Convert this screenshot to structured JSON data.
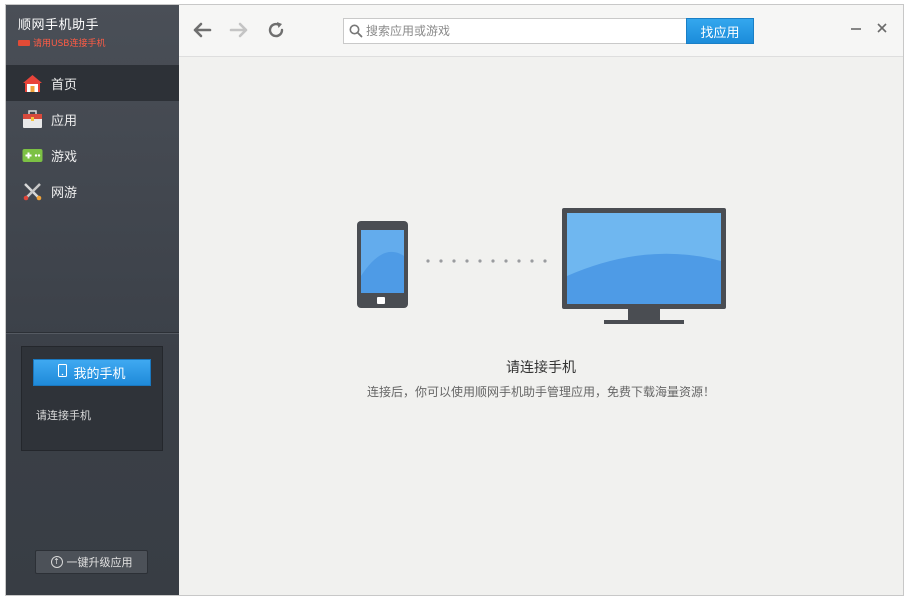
{
  "app": {
    "title": "顺网手机助手",
    "subtitle": "请用USB连接手机"
  },
  "sidebar": {
    "items": [
      {
        "label": "首页",
        "icon": "home-icon",
        "active": true
      },
      {
        "label": "应用",
        "icon": "app-bag-icon",
        "active": false
      },
      {
        "label": "游戏",
        "icon": "gamepad-icon",
        "active": false
      },
      {
        "label": "网游",
        "icon": "crossed-swords-icon",
        "active": false
      }
    ],
    "phone_panel": {
      "button_label": "我的手机",
      "status": "请连接手机"
    },
    "upgrade_label": "一键升级应用"
  },
  "toolbar": {
    "search_placeholder": "搜索应用或游戏",
    "search_value": "",
    "search_button": "找应用"
  },
  "main": {
    "title": "请连接手机",
    "description": "连接后，你可以使用顺网手机助手管理应用，免费下载海量资源！"
  },
  "colors": {
    "accent": "#1f8ad9",
    "sidebar_bg": "#3e434a",
    "warning_text": "#ff5c45",
    "content_bg": "#f1f1ef"
  }
}
